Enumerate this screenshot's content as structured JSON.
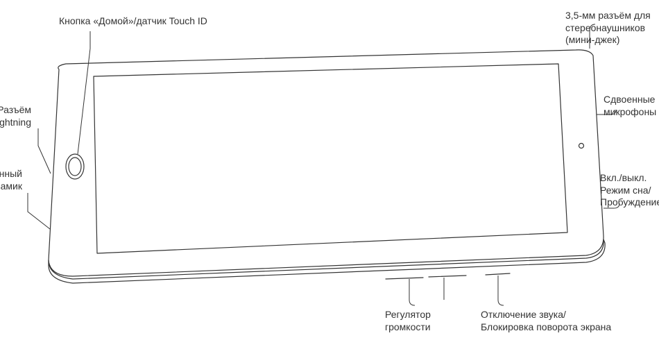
{
  "labels": {
    "home_button": "Кнопка «Домой»/датчик Touch ID",
    "lightning": "Разъём\nLightning",
    "speaker": "Встроенный\nдинамик",
    "headphone": "3,5-мм разъём для\nстереонаушников\n(мини-джек)",
    "dual_mics": "Сдвоенные\nмикрофоны",
    "sleep_wake": "Вкл./выкл.\nРежим сна/\nПробуждение",
    "volume": "Регулятор\nгромкости",
    "mute_lock": "Отключение звука/\nБлокировка поворота экрана"
  }
}
